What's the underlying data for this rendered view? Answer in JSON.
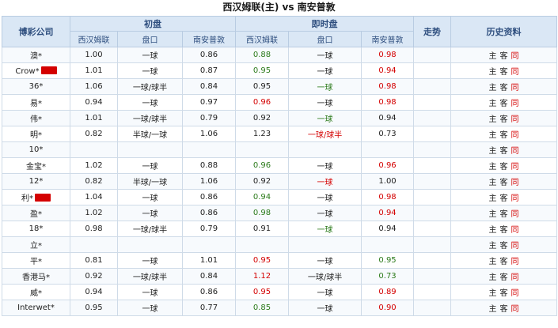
{
  "title": "西汉姆联(主) vs 南安普敦",
  "header": {
    "company": "博彩公司",
    "initial": "初盘",
    "live": "即时盘",
    "trend": "走势",
    "history": "历史资料",
    "home": "西汉姆联",
    "handicap": "盘口",
    "away": "南安普敦"
  },
  "rows": [
    {
      "name": "澳*",
      "badge": false,
      "i_home": "1.00",
      "i_hcap": "一球",
      "i_away": "0.86",
      "l_home": "0.88",
      "l_home_c": "g",
      "l_hcap": "一球",
      "l_hcap_c": "",
      "l_away": "0.98",
      "l_away_c": "r",
      "links": [
        "主",
        "客",
        "同"
      ]
    },
    {
      "name": "Crow*",
      "badge": true,
      "i_home": "1.01",
      "i_hcap": "一球",
      "i_away": "0.87",
      "l_home": "0.95",
      "l_home_c": "g",
      "l_hcap": "一球",
      "l_hcap_c": "",
      "l_away": "0.94",
      "l_away_c": "r",
      "links": [
        "主",
        "客",
        "同"
      ]
    },
    {
      "name": "36*",
      "badge": false,
      "i_home": "1.06",
      "i_hcap": "一球/球半",
      "i_away": "0.84",
      "l_home": "0.95",
      "l_home_c": "",
      "l_hcap": "一球",
      "l_hcap_c": "g",
      "l_away": "0.98",
      "l_away_c": "r",
      "links": [
        "主",
        "客",
        "同"
      ]
    },
    {
      "name": "易*",
      "badge": false,
      "i_home": "0.94",
      "i_hcap": "一球",
      "i_away": "0.97",
      "l_home": "0.96",
      "l_home_c": "r",
      "l_hcap": "一球",
      "l_hcap_c": "",
      "l_away": "0.98",
      "l_away_c": "r",
      "links": [
        "主",
        "客",
        "同"
      ]
    },
    {
      "name": "伟*",
      "badge": false,
      "i_home": "1.01",
      "i_hcap": "一球/球半",
      "i_away": "0.79",
      "l_home": "0.92",
      "l_home_c": "",
      "l_hcap": "一球",
      "l_hcap_c": "g",
      "l_away": "0.94",
      "l_away_c": "",
      "links": [
        "主",
        "客",
        "同"
      ]
    },
    {
      "name": "明*",
      "badge": false,
      "i_home": "0.82",
      "i_hcap": "半球/一球",
      "i_away": "1.06",
      "l_home": "1.23",
      "l_home_c": "",
      "l_hcap": "一球/球半",
      "l_hcap_c": "r",
      "l_away": "0.73",
      "l_away_c": "",
      "links": [
        "主",
        "客",
        "同"
      ]
    },
    {
      "name": "10*",
      "badge": false,
      "i_home": "",
      "i_hcap": "",
      "i_away": "",
      "l_home": "",
      "l_home_c": "",
      "l_hcap": "",
      "l_hcap_c": "",
      "l_away": "",
      "l_away_c": "",
      "links": [
        "主",
        "客",
        "同"
      ]
    },
    {
      "name": "金宝*",
      "badge": false,
      "i_home": "1.02",
      "i_hcap": "一球",
      "i_away": "0.88",
      "l_home": "0.96",
      "l_home_c": "g",
      "l_hcap": "一球",
      "l_hcap_c": "",
      "l_away": "0.96",
      "l_away_c": "r",
      "links": [
        "主",
        "客",
        "同"
      ]
    },
    {
      "name": "12*",
      "badge": false,
      "i_home": "0.82",
      "i_hcap": "半球/一球",
      "i_away": "1.06",
      "l_home": "0.92",
      "l_home_c": "",
      "l_hcap": "一球",
      "l_hcap_c": "r",
      "l_away": "1.00",
      "l_away_c": "",
      "links": [
        "主",
        "客",
        "同"
      ]
    },
    {
      "name": "利*",
      "badge": true,
      "i_home": "1.04",
      "i_hcap": "一球",
      "i_away": "0.86",
      "l_home": "0.94",
      "l_home_c": "g",
      "l_hcap": "一球",
      "l_hcap_c": "",
      "l_away": "0.98",
      "l_away_c": "r",
      "links": [
        "主",
        "客",
        "同"
      ]
    },
    {
      "name": "盈*",
      "badge": false,
      "i_home": "1.02",
      "i_hcap": "一球",
      "i_away": "0.86",
      "l_home": "0.98",
      "l_home_c": "g",
      "l_hcap": "一球",
      "l_hcap_c": "",
      "l_away": "0.94",
      "l_away_c": "r",
      "links": [
        "主",
        "客",
        "同"
      ]
    },
    {
      "name": "18*",
      "badge": false,
      "i_home": "0.98",
      "i_hcap": "一球/球半",
      "i_away": "0.79",
      "l_home": "0.91",
      "l_home_c": "",
      "l_hcap": "一球",
      "l_hcap_c": "g",
      "l_away": "0.94",
      "l_away_c": "",
      "links": [
        "主",
        "客",
        "同"
      ]
    },
    {
      "name": "立*",
      "badge": false,
      "i_home": "",
      "i_hcap": "",
      "i_away": "",
      "l_home": "",
      "l_home_c": "",
      "l_hcap": "",
      "l_hcap_c": "",
      "l_away": "",
      "l_away_c": "",
      "links": [
        "主",
        "客",
        "同"
      ]
    },
    {
      "name": "平*",
      "badge": false,
      "i_home": "0.81",
      "i_hcap": "一球",
      "i_away": "1.01",
      "l_home": "0.95",
      "l_home_c": "r",
      "l_hcap": "一球",
      "l_hcap_c": "",
      "l_away": "0.95",
      "l_away_c": "g",
      "links": [
        "主",
        "客",
        "同"
      ]
    },
    {
      "name": "香港马*",
      "badge": false,
      "i_home": "0.92",
      "i_hcap": "一球/球半",
      "i_away": "0.84",
      "l_home": "1.12",
      "l_home_c": "r",
      "l_hcap": "一球/球半",
      "l_hcap_c": "",
      "l_away": "0.73",
      "l_away_c": "g",
      "links": [
        "主",
        "客",
        "同"
      ]
    },
    {
      "name": "威*",
      "badge": false,
      "i_home": "0.94",
      "i_hcap": "一球",
      "i_away": "0.86",
      "l_home": "0.95",
      "l_home_c": "r",
      "l_hcap": "一球",
      "l_hcap_c": "",
      "l_away": "0.89",
      "l_away_c": "r",
      "links": [
        "主",
        "客",
        "同"
      ]
    },
    {
      "name": "Interwet*",
      "badge": false,
      "i_home": "0.95",
      "i_hcap": "一球",
      "i_away": "0.77",
      "l_home": "0.85",
      "l_home_c": "g",
      "l_hcap": "一球",
      "l_hcap_c": "",
      "l_away": "0.90",
      "l_away_c": "r",
      "links": [
        "主",
        "客",
        "同"
      ]
    }
  ]
}
